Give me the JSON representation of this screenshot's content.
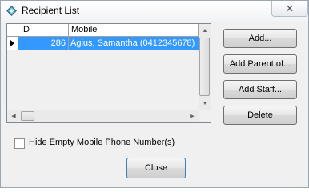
{
  "window": {
    "title": "Recipient List",
    "close_glyph": "✕",
    "icon": "app-diamond-icon"
  },
  "grid": {
    "columns": [
      "ID",
      "Mobile"
    ],
    "rows": [
      {
        "id": "286",
        "mobile": "Agius, Samantha (0412345678)",
        "selected": true
      }
    ],
    "selection_color": "#3399ff"
  },
  "buttons": {
    "add": "Add...",
    "add_parent": "Add Parent of...",
    "add_staff": "Add Staff...",
    "delete": "Delete",
    "close": "Close"
  },
  "options": {
    "hide_empty_label": "Hide Empty Mobile Phone Number(s)",
    "hide_empty_checked": false
  }
}
